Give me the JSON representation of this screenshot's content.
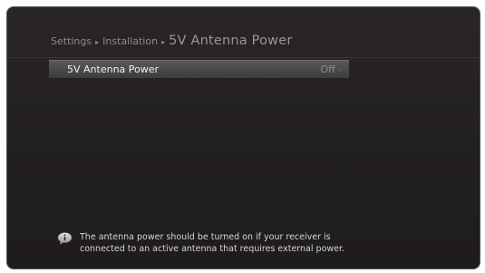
{
  "breadcrumb": {
    "items": [
      "Settings",
      "Installation"
    ],
    "current": "5V Antenna Power",
    "separator": "▸"
  },
  "menu": {
    "items": [
      {
        "label": "5V Antenna Power",
        "value": "Off",
        "chevron": "›"
      }
    ]
  },
  "info": {
    "icon": "info-icon",
    "line1": "The antenna power should be turned on if your receiver is",
    "line2": "connected to an active antenna that requires external power."
  },
  "colors": {
    "background": "#221f1f",
    "highlight": "#4c4949",
    "text": "#f2f0f0",
    "muted": "#8f8b8b"
  }
}
